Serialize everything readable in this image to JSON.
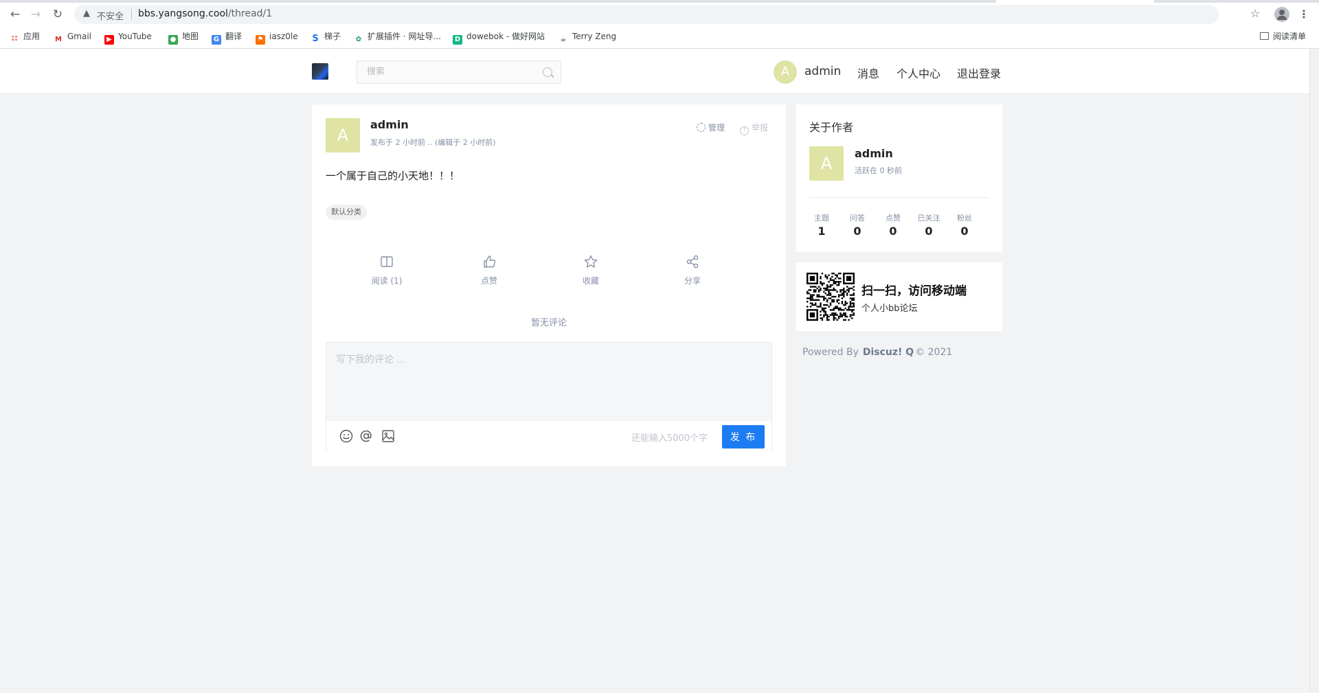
{
  "browser": {
    "insecure_label": "不安全",
    "url_domain": "bbs.yangsong.cool",
    "url_path": "/thread/1",
    "bookmarks": [
      {
        "label": "应用",
        "color": "#ea4335"
      },
      {
        "label": "Gmail",
        "color": "#d93025"
      },
      {
        "label": "YouTube",
        "color": "#ff0000"
      },
      {
        "label": "地图",
        "color": "#34a853"
      },
      {
        "label": "翻译",
        "color": "#4285f4"
      },
      {
        "label": "iasz0le",
        "color": "#ff6d00"
      },
      {
        "label": "梯子",
        "color": "#1a73e8"
      },
      {
        "label": "扩展插件 · 网址导...",
        "color": "#0f9d58"
      },
      {
        "label": "dowebok - 做好网站",
        "color": "#12b886"
      },
      {
        "label": "Terry Zeng",
        "color": "#202124"
      }
    ],
    "reading_list": "阅读清单"
  },
  "header": {
    "search_placeholder": "搜索",
    "avatar_letter": "A",
    "username": "admin",
    "nav": [
      "消息",
      "个人中心",
      "退出登录"
    ]
  },
  "post": {
    "avatar_letter": "A",
    "author": "admin",
    "meta": "发布于 2 小时前 ..  (编辑于 2 小时前)",
    "manage": "管理",
    "report": "举报",
    "content": "一个属于自己的小天地！！！",
    "tag": "默认分类",
    "actions": [
      {
        "label": "阅读 (1)",
        "icon": "book-icon"
      },
      {
        "label": "点赞",
        "icon": "thumbs-up-icon"
      },
      {
        "label": "收藏",
        "icon": "star-icon"
      },
      {
        "label": "分享",
        "icon": "share-icon"
      }
    ],
    "no_comments": "暂无评论"
  },
  "comment": {
    "placeholder": "写下我的评论 ...",
    "remaining": "还能输入5000个字",
    "submit": "发 布"
  },
  "author_card": {
    "title": "关于作者",
    "avatar_letter": "A",
    "name": "admin",
    "active": "活跃在 0 秒前",
    "stats": [
      {
        "label": "主题",
        "value": "1"
      },
      {
        "label": "问答",
        "value": "0"
      },
      {
        "label": "点赞",
        "value": "0"
      },
      {
        "label": "已关注",
        "value": "0"
      },
      {
        "label": "粉丝",
        "value": "0"
      }
    ]
  },
  "qr_card": {
    "title": "扫一扫，访问移动端",
    "subtitle": "个人小bb论坛"
  },
  "footer": {
    "powered_by": "Powered By",
    "brand": "Discuz! Q",
    "copyright": "© 2021"
  },
  "colors": {
    "accent": "#1e7cf2",
    "avatar": "#dfe3a3",
    "page_bg": "#f2f3f5"
  }
}
